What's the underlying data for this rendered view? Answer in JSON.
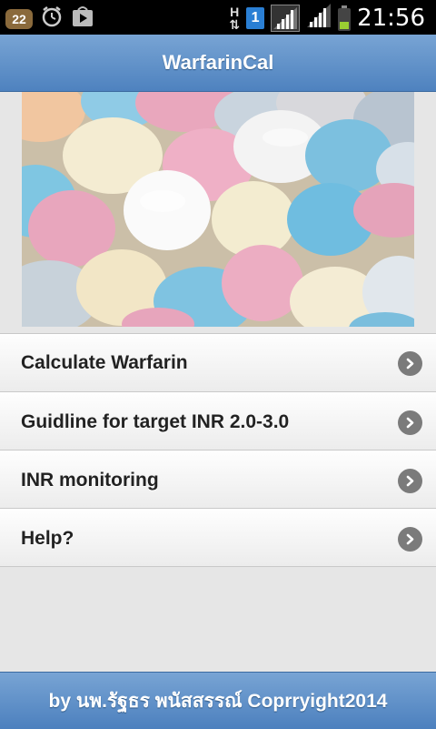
{
  "statusbar": {
    "notification_count": "22",
    "network_type": "H",
    "sim_slot": "1",
    "time": "21:56",
    "icons": [
      "notification-badge-icon",
      "alarm-clock-icon",
      "play-store-icon",
      "network-type-icon",
      "sim-icon",
      "signal-icon",
      "signal-icon",
      "battery-icon"
    ]
  },
  "header": {
    "title": "WarfarinCal"
  },
  "hero": {
    "image": "colorful-pills-photo"
  },
  "menu": {
    "items": [
      {
        "label": "Calculate Warfarin",
        "icon": "chevron-right-icon"
      },
      {
        "label": "Guidline for target INR 2.0-3.0",
        "icon": "chevron-right-icon"
      },
      {
        "label": "INR monitoring",
        "icon": "chevron-right-icon"
      },
      {
        "label": "Help?",
        "icon": "chevron-right-icon"
      }
    ]
  },
  "footer": {
    "text": "by นพ.รัฐธร พนัสสรรณ์ Coprryight2014"
  },
  "colors": {
    "header_blue": "#5f8fc8",
    "list_text": "#222222",
    "chevron_bg": "#7b7b7b",
    "page_bg": "#e6e6e6"
  }
}
